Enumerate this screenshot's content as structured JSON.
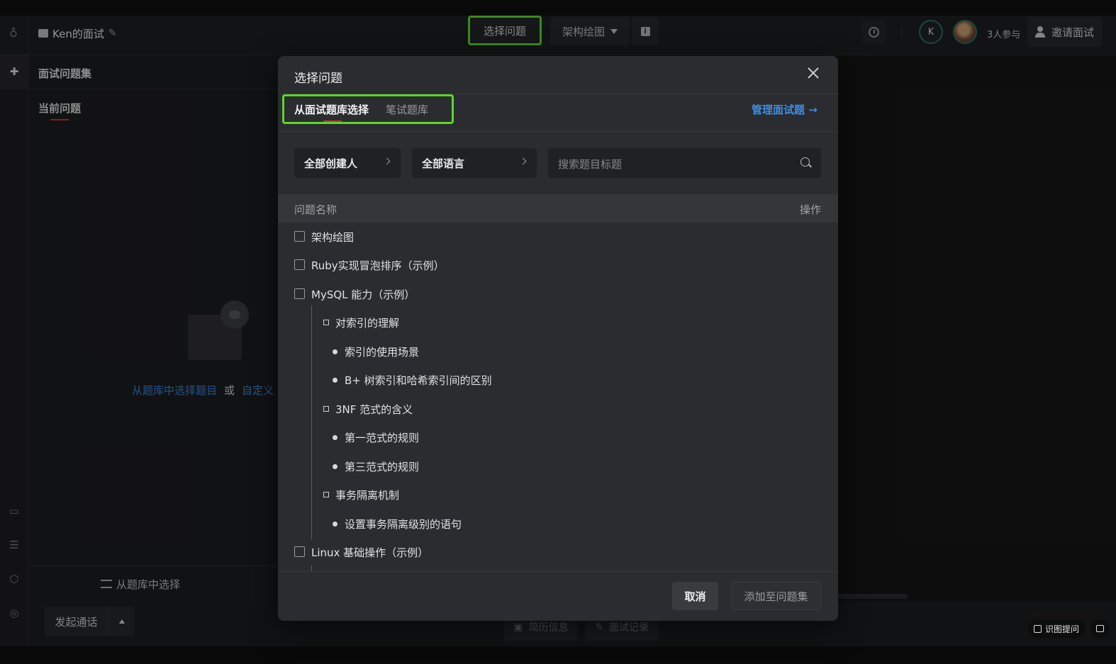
{
  "header": {
    "interview_title": "Ken的面试",
    "select_question_label": "选择问题",
    "arch_drawing_label": "架构绘图",
    "avatar_initial": "K",
    "participants": "3人参与",
    "invite_label": "邀请面试"
  },
  "left_panel": {
    "title": "面试问题集",
    "current_tab": "当前问题",
    "empty_link_library": "从题库中选择题目",
    "empty_or": "或",
    "empty_link_custom": "自定义",
    "bottom_tab": "从题库中选择",
    "call_button": "发起通话"
  },
  "bottom_bar": {
    "resume_label": "简历信息",
    "record_label": "面试记录",
    "ocr_label": "识图提问"
  },
  "modal": {
    "title": "选择问题",
    "tabs": [
      {
        "label": "从面试题库选择",
        "active": true
      },
      {
        "label": "笔试题库",
        "active": false
      }
    ],
    "manage_link": "管理面试题 →",
    "filters": {
      "creator": "全部创建人",
      "language": "全部语言",
      "search_placeholder": "搜索题目标题"
    },
    "table": {
      "col_name": "问题名称",
      "col_action": "操作"
    },
    "rows": [
      {
        "level": 0,
        "label": "架构绘图"
      },
      {
        "level": 0,
        "label": "Ruby实现冒泡排序（示例）"
      },
      {
        "level": 0,
        "label": "MySQL 能力（示例）"
      },
      {
        "level": 1,
        "label": "对索引的理解"
      },
      {
        "level": 2,
        "label": "索引的使用场景"
      },
      {
        "level": 2,
        "label": "B+ 树索引和哈希索引间的区别"
      },
      {
        "level": 1,
        "label": "3NF 范式的含义"
      },
      {
        "level": 2,
        "label": "第一范式的规则"
      },
      {
        "level": 2,
        "label": "第三范式的规则"
      },
      {
        "level": 1,
        "label": "事务隔离机制"
      },
      {
        "level": 2,
        "label": "设置事务隔离级别的语句"
      },
      {
        "level": 0,
        "label": "Linux 基础操作（示例）"
      }
    ],
    "cancel_label": "取消",
    "add_label": "添加至问题集"
  },
  "colors": {
    "highlight_green": "#5bd62b",
    "link_blue": "#3d8de8",
    "tab_underline_red": "#c8352a"
  }
}
